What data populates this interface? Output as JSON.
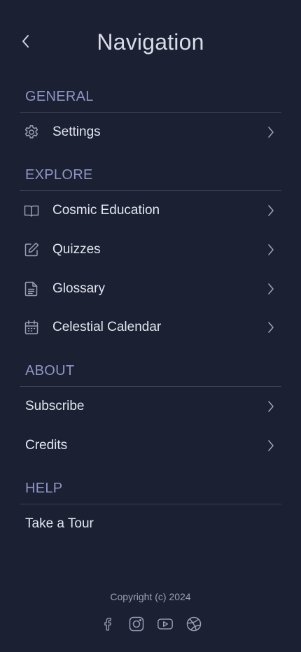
{
  "header": {
    "title": "Navigation"
  },
  "sections": {
    "general": {
      "title": "GENERAL",
      "items": [
        {
          "label": "Settings",
          "icon": "gear-icon"
        }
      ]
    },
    "explore": {
      "title": "EXPLORE",
      "items": [
        {
          "label": "Cosmic Education",
          "icon": "book-icon"
        },
        {
          "label": "Quizzes",
          "icon": "edit-icon"
        },
        {
          "label": "Glossary",
          "icon": "document-icon"
        },
        {
          "label": "Celestial Calendar",
          "icon": "calendar-icon"
        }
      ]
    },
    "about": {
      "title": "ABOUT",
      "items": [
        {
          "label": "Subscribe"
        },
        {
          "label": "Credits"
        }
      ]
    },
    "help": {
      "title": "HELP",
      "items": [
        {
          "label": "Take a Tour"
        }
      ]
    }
  },
  "footer": {
    "copyright": "Copyright (c) 2024",
    "socials": [
      "facebook-icon",
      "instagram-icon",
      "youtube-icon",
      "dribbble-icon"
    ]
  },
  "colors": {
    "background": "#1b2033",
    "section_title": "#8f96c4",
    "text": "#e3e6ef",
    "divider": "#3b4257",
    "icon": "#9aa0b5"
  }
}
